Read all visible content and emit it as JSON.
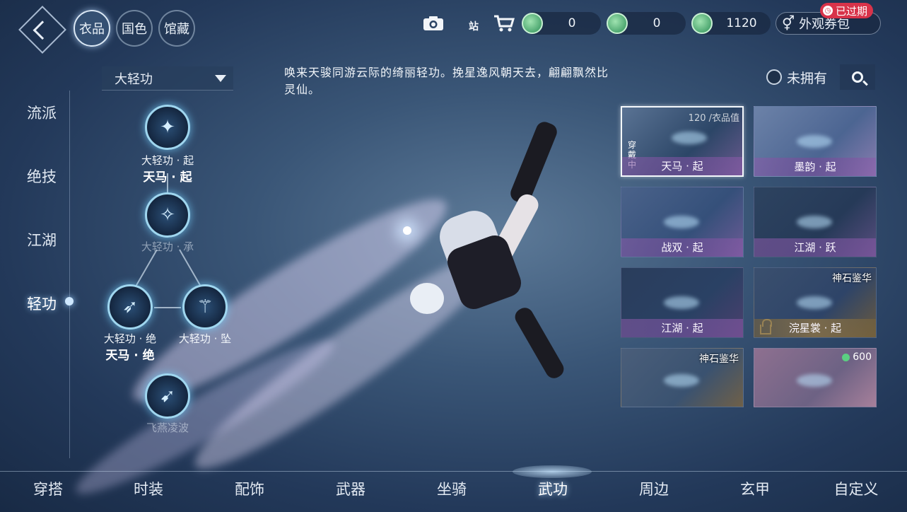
{
  "top_bar": {
    "category_tabs": [
      {
        "label": "衣品",
        "active": true
      },
      {
        "label": "国色",
        "active": false
      },
      {
        "label": "馆藏",
        "active": false
      }
    ],
    "icons": [
      "camera-icon",
      "shop-station-icon",
      "cart-icon"
    ],
    "station_label": "站",
    "currencies": [
      {
        "name": "green-coin-1",
        "value": "0"
      },
      {
        "name": "green-coin-2",
        "value": "0"
      },
      {
        "name": "green-coin-3",
        "value": "1120"
      }
    ],
    "coupon": {
      "label": "外观券包",
      "badge": "已过期"
    }
  },
  "filter": {
    "dropdown_value": "大轻功",
    "owned_toggle_label": "未拥有"
  },
  "description": "唤来天骏同游云际的绮丽轻功。挽星逸风朝天去，翩翩飘然比灵仙。",
  "left_nav": [
    {
      "label": "流派",
      "active": false
    },
    {
      "label": "绝技",
      "active": false
    },
    {
      "label": "江湖",
      "active": false
    },
    {
      "label": "轻功",
      "active": true
    }
  ],
  "skill_tree": [
    {
      "label": "大轻功 · 起",
      "sub": "天马 · 起"
    },
    {
      "label": "大轻功 · 承",
      "sub": ""
    },
    {
      "label": "大轻功 · 绝",
      "sub": "天马 · 绝"
    },
    {
      "label": "大轻功 · 坠",
      "sub": ""
    },
    {
      "label": "飞燕凌波",
      "sub": ""
    }
  ],
  "cards": [
    {
      "name": "天马 · 起",
      "value": "120 /衣品值",
      "worn": "穿戴中",
      "selected": true
    },
    {
      "name": "墨韵 · 起"
    },
    {
      "name": "战双 · 起"
    },
    {
      "name": "江湖 · 跃"
    },
    {
      "name": "江湖 · 起"
    },
    {
      "name": "浣星裳 · 起",
      "tag": "神石鉴华"
    },
    {
      "name": "",
      "tag": "神石鉴华"
    },
    {
      "name": "",
      "price": "600"
    }
  ],
  "bottom_nav": [
    {
      "label": "穿搭",
      "active": false
    },
    {
      "label": "时装",
      "active": false
    },
    {
      "label": "配饰",
      "active": false
    },
    {
      "label": "武器",
      "active": false
    },
    {
      "label": "坐骑",
      "active": false
    },
    {
      "label": "武功",
      "active": true
    },
    {
      "label": "周边",
      "active": false
    },
    {
      "label": "玄甲",
      "active": false
    },
    {
      "label": "自定义",
      "active": false
    }
  ],
  "colors": {
    "accent_glow": "#9fd2ff",
    "expired_badge": "#d8334a",
    "currency_green": "#2c8f57"
  }
}
